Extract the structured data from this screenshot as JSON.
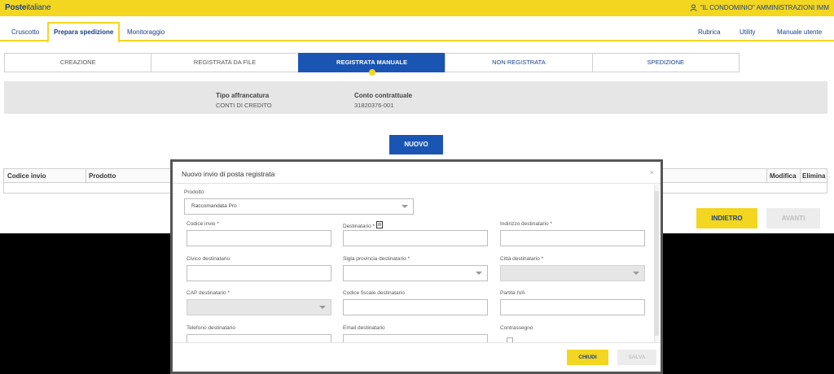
{
  "header": {
    "logo_bold": "Poste",
    "logo_light": "italiane",
    "user_label": "\"IL CONDOMINIO\" AMMINISTRAZIONI IMM",
    "brand_color": "#f2d61f",
    "primary_color": "#1a55b3"
  },
  "nav": {
    "tabs": [
      {
        "label": "Cruscotto"
      },
      {
        "label": "Prepara spedizione"
      },
      {
        "label": "Monitoraggio"
      }
    ],
    "active_tab": "Prepara spedizione",
    "right_links": [
      {
        "label": "Rubrica"
      },
      {
        "label": "Utility"
      },
      {
        "label": "Manuale utente"
      }
    ]
  },
  "steps": [
    {
      "label": "CREAZIONE"
    },
    {
      "label": "REGISTRATA DA FILE"
    },
    {
      "label": "REGISTRATA MANUALE"
    },
    {
      "label": "NON REGISTRATA"
    },
    {
      "label": "SPEDIZIONE"
    }
  ],
  "active_step": "REGISTRATA MANUALE",
  "info": {
    "tipo_label": "Tipo affrancatura",
    "tipo_value": "CONTI DI CREDITO",
    "conto_label": "Conto contrattuale",
    "conto_value": "31820376-001"
  },
  "nuovo_button": "NUOVO",
  "table": {
    "headers_left": [
      "Codice invio",
      "Prodotto"
    ],
    "headers_right": [
      "Modifica",
      "Elimina"
    ]
  },
  "buttons": {
    "indietro": "INDIETRO",
    "avanti": "AVANTI"
  },
  "modal": {
    "title": "Nuovo invio di posta registrata",
    "close": "×",
    "prodotto_label": "Prodotto",
    "prodotto_value": "Raccomandata Pro",
    "fields": {
      "codice_invio": "Codice invio *",
      "destinatario": "Destinatario *",
      "indirizzo": "Indirizzo destinatario *",
      "civico": "Civico destinatario",
      "sigla_provincia": "Sigla provincia destinatario *",
      "citta": "Città destinatario *",
      "cap": "CAP destinatario *",
      "codice_fiscale": "Codice fiscale destinatario",
      "partita_iva": "Partita IVA",
      "telefono": "Telefono destinatario",
      "email": "Email destinatario",
      "contrassegno": "Contrassegno"
    },
    "chiudi": "CHIUDI",
    "salva": "SALVA"
  }
}
